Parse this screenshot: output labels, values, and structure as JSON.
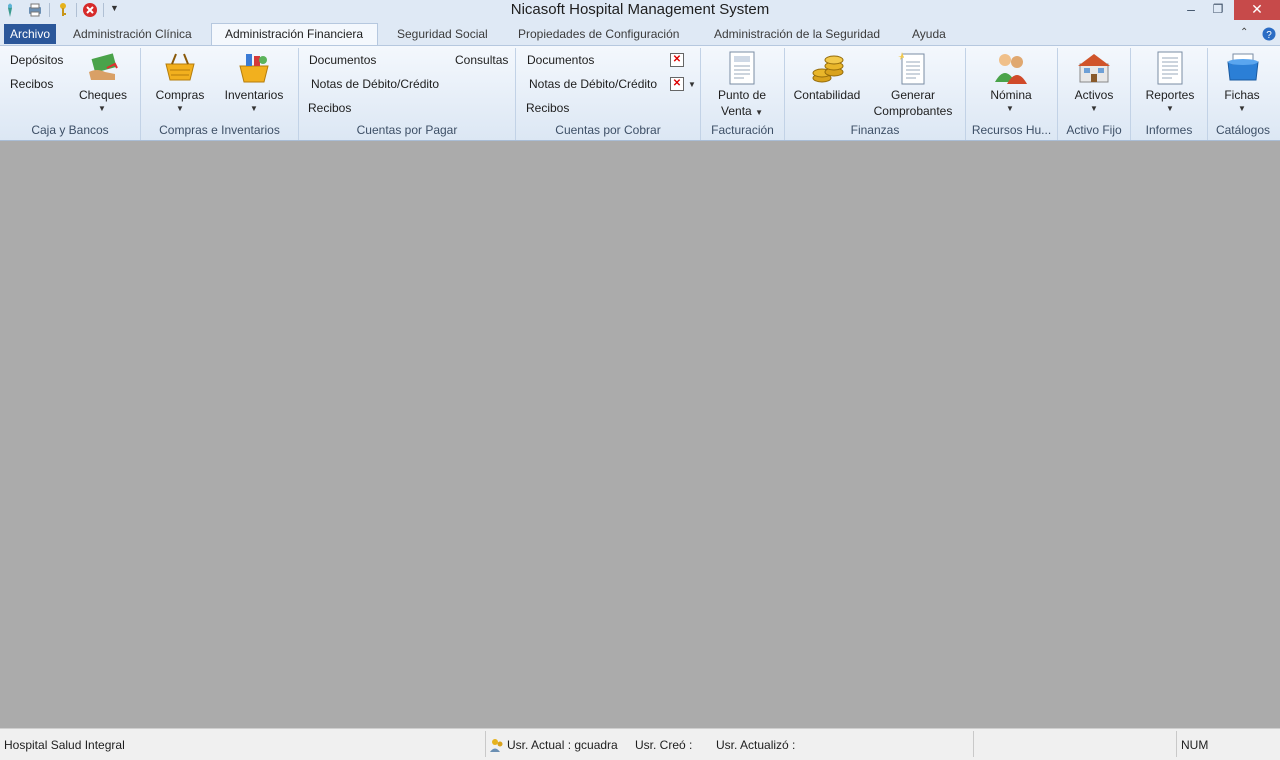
{
  "window": {
    "title": "Nicasoft Hospital Management System"
  },
  "tabs": {
    "archivo": "Archivo",
    "clinica": "Administración Clínica",
    "financiera": "Administración Financiera",
    "seguridad_social": "Seguridad Social",
    "propiedades": "Propiedades de Configuración",
    "admin_seguridad": "Administración de la Seguridad",
    "ayuda": "Ayuda"
  },
  "ribbon": {
    "caja": {
      "depositos": "Depósitos",
      "recibos": "Recibos",
      "cheques": "Cheques",
      "label": "Caja y Bancos"
    },
    "compras": {
      "compras": "Compras",
      "inventarios": "Inventarios",
      "label": "Compras e Inventarios"
    },
    "pagar": {
      "documentos": "Documentos",
      "consultas": "Consultas",
      "notas": "Notas de Débito/Crédito",
      "recibos": "Recibos",
      "label": "Cuentas por Pagar"
    },
    "cobrar": {
      "documentos": "Documentos",
      "notas": "Notas de Débito/Crédito",
      "recibos": "Recibos",
      "label": "Cuentas por Cobrar"
    },
    "facturacion": {
      "punto_1": "Punto de",
      "punto_2": "Venta",
      "label": "Facturación"
    },
    "finanzas": {
      "contabilidad": "Contabilidad",
      "generar_1": "Generar",
      "generar_2": "Comprobantes",
      "label": "Finanzas"
    },
    "rrhh": {
      "nomina": "Nómina",
      "label": "Recursos Hu..."
    },
    "activo": {
      "activos": "Activos",
      "label": "Activo Fijo"
    },
    "informes": {
      "reportes": "Reportes",
      "label": "Informes"
    },
    "catalogos": {
      "fichas": "Fichas",
      "label": "Catálogos"
    }
  },
  "status": {
    "hospital": "Hospital Salud Integral",
    "usr_actual": "Usr. Actual : gcuadra",
    "usr_creo": "Usr. Creó :",
    "usr_actualizo": "Usr. Actualizó :",
    "num": "NUM"
  }
}
